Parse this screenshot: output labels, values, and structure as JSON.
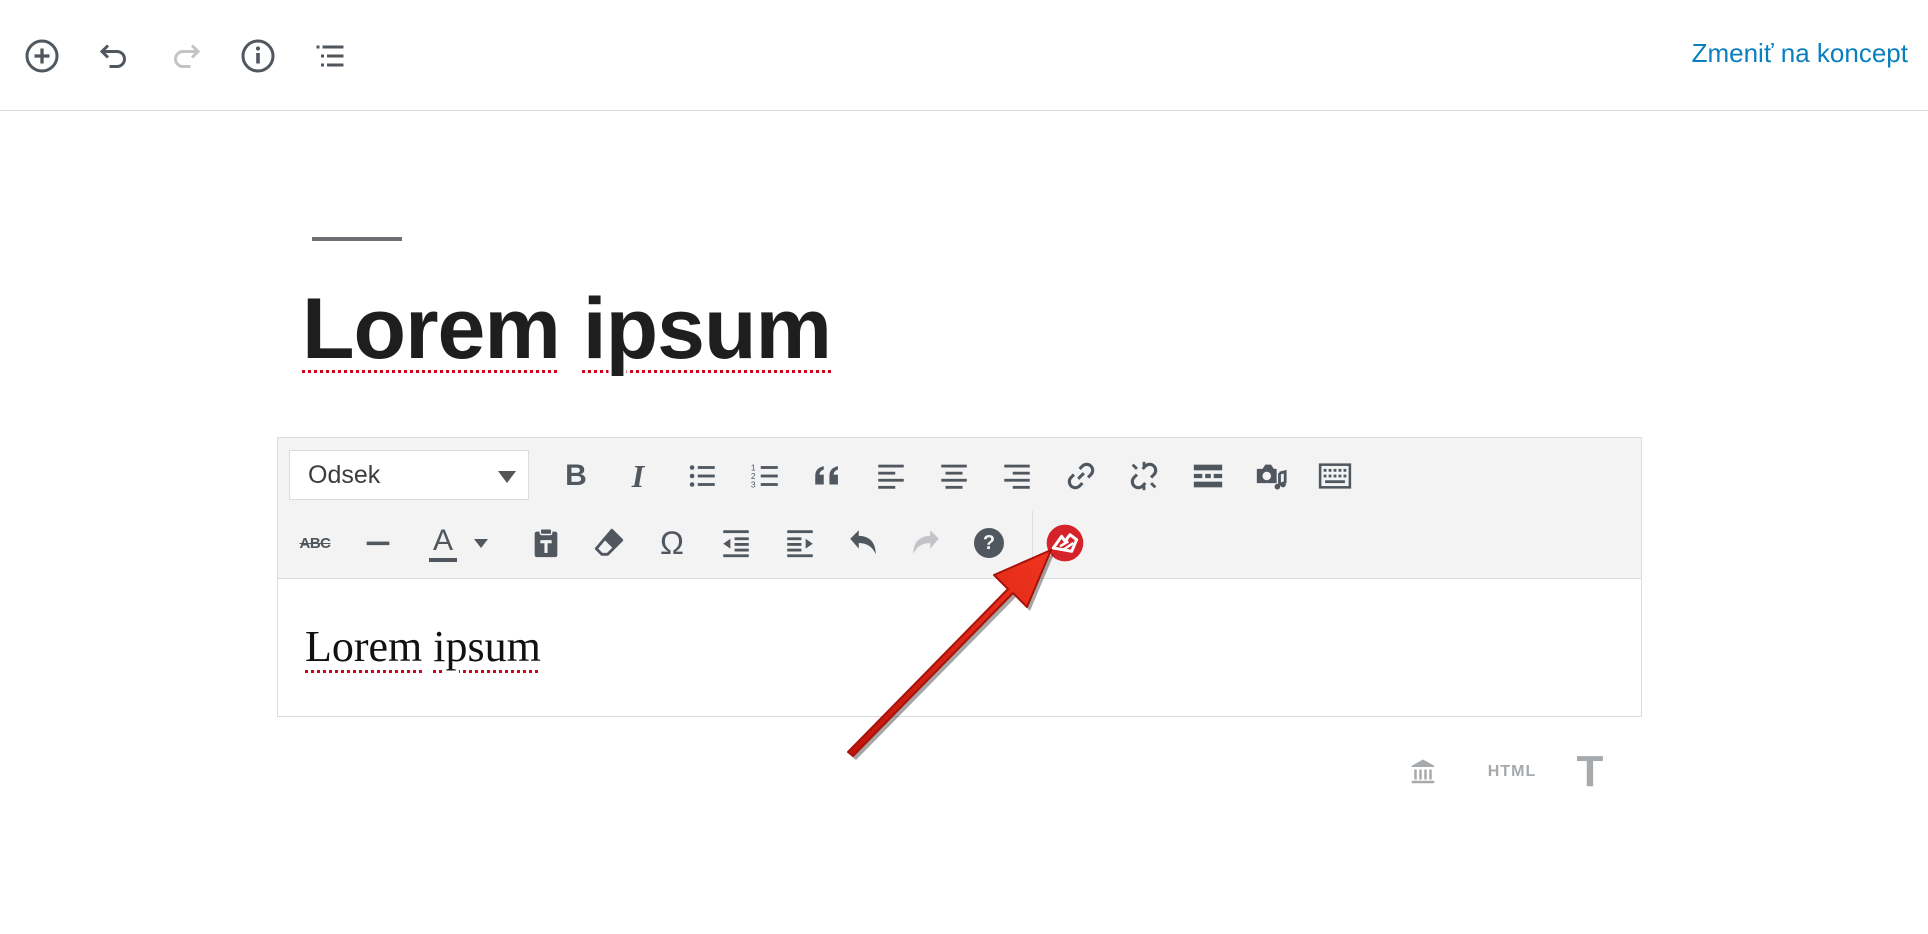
{
  "topbar": {
    "switch_to_draft_label": "Zmeniť na koncept",
    "icons": [
      "add-block-icon",
      "undo-icon",
      "redo-icon",
      "info-icon",
      "outline-icon"
    ]
  },
  "post": {
    "title_words": [
      "Lorem",
      "ipsum"
    ]
  },
  "editor": {
    "format_select": {
      "value": "Odsek"
    },
    "row1_tools": [
      "bold",
      "italic",
      "bulleted-list",
      "numbered-list",
      "blockquote",
      "align-left",
      "align-center",
      "align-right",
      "insert-link",
      "remove-link",
      "read-more",
      "add-media",
      "toolbar-toggle"
    ],
    "row2_tools": [
      "strikethrough",
      "horizontal-line",
      "text-color",
      "text-color-dropdown",
      "paste-as-text",
      "clear-formatting",
      "special-character",
      "outdent",
      "indent",
      "undo",
      "redo",
      "keyboard-shortcuts",
      "plugin"
    ],
    "strikethrough_label": "ABC",
    "text_color_letter": "A",
    "special_char_glyph": "Ω",
    "help_glyph": "?",
    "bold_glyph": "B",
    "italic_glyph": "I",
    "content_words": [
      "Lorem",
      "ipsum"
    ]
  },
  "bottom_modes": {
    "html_label": "HTML",
    "text_label": "T"
  },
  "colors": {
    "accent_link": "#0a7fbf",
    "icon_dark": "#50575e",
    "icon_disabled": "#c3c4c7",
    "spell_underline": "#d0021b",
    "plugin_red": "#d6232a",
    "annotation_arrow": "#e2231a"
  }
}
